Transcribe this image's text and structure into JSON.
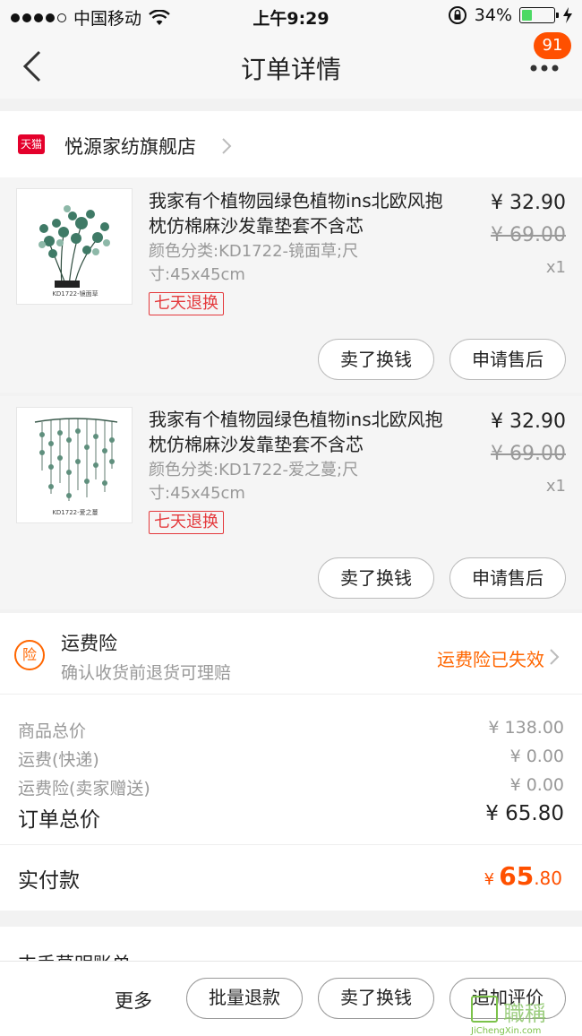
{
  "status_bar": {
    "carrier": "中国移动",
    "time": "上午9:29",
    "battery_percent": "34%",
    "battery_level": 0.34,
    "signal_bars": 4,
    "signal_total": 5,
    "icons": [
      "wifi-icon",
      "orientation-lock-icon",
      "battery-icon",
      "charging-icon"
    ]
  },
  "nav": {
    "title": "订单详情",
    "badge_count": "91",
    "icons": [
      "back-chevron-icon",
      "more-dots-icon"
    ]
  },
  "shop": {
    "tmall_label": "天猫",
    "name": "悦源家纺旗舰店"
  },
  "items": [
    {
      "title": "我家有个植物园绿色植物ins北欧风抱枕仿棉麻沙发靠垫套不含芯",
      "sku": "颜色分类:KD1722-镜面草;尺寸:45x45cm",
      "return_badge": "七天退换",
      "price": "¥ 32.90",
      "original_price": "¥ 69.00",
      "quantity": "x1",
      "thumb_caption": "KD1722-镜面草",
      "btn_sell": "卖了换钱",
      "btn_after_sale": "申请售后"
    },
    {
      "title": "我家有个植物园绿色植物ins北欧风抱枕仿棉麻沙发靠垫套不含芯",
      "sku": "颜色分类:KD1722-爱之蔓;尺寸:45x45cm",
      "return_badge": "七天退换",
      "price": "¥ 32.90",
      "original_price": "¥ 69.00",
      "quantity": "x1",
      "thumb_caption": "KD1722-爱之蔓",
      "btn_sell": "卖了换钱",
      "btn_after_sale": "申请售后"
    }
  ],
  "insurance": {
    "icon_label": "险",
    "title": "运费险",
    "subtitle": "确认收货前退货可理赔",
    "status": "运费险已失效"
  },
  "summary": {
    "rows": [
      {
        "label": "商品总价",
        "value": "¥ 138.00"
      },
      {
        "label": "运费(快递)",
        "value": "¥ 0.00"
      },
      {
        "label": "运费险(卖家赠送)",
        "value": "¥ 0.00"
      }
    ],
    "total_label": "订单总价",
    "total_value": "¥ 65.80",
    "paid_label": "实付款",
    "paid_currency": "¥",
    "paid_integer": "65",
    "paid_decimal": ".80"
  },
  "peek_text": "支手莫明账单",
  "bottom_bar": {
    "more": "更多",
    "batch_refund": "批量退款",
    "sell": "卖了换钱",
    "add_review": "追加评价"
  },
  "watermark": {
    "cn": "職稱",
    "en": "JiChengXin.com"
  },
  "colors": {
    "accent": "#ff5000",
    "tmall_red": "#e4002b",
    "insurance_orange": "#ff6600",
    "return_badge_red": "#e4393c"
  }
}
